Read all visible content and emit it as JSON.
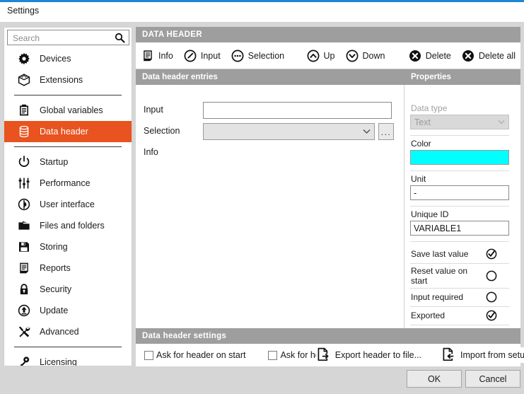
{
  "window": {
    "title": "Settings",
    "accent_color": "#1f86d6"
  },
  "search": {
    "placeholder": "Search",
    "value": "",
    "icon": "search-icon"
  },
  "sidebar": {
    "groups": [
      {
        "items": [
          {
            "label": "Devices",
            "icon": "gear-icon",
            "selected": false
          },
          {
            "label": "Extensions",
            "icon": "box-icon",
            "selected": false
          }
        ]
      },
      {
        "items": [
          {
            "label": "Global variables",
            "icon": "clipboard-icon",
            "selected": false
          },
          {
            "label": "Data header",
            "icon": "database-icon",
            "selected": true
          }
        ]
      },
      {
        "items": [
          {
            "label": "Startup",
            "icon": "power-icon",
            "selected": false
          },
          {
            "label": "Performance",
            "icon": "sliders-icon",
            "selected": false
          },
          {
            "label": "User interface",
            "icon": "user-interface-icon",
            "selected": false
          },
          {
            "label": "Files and folders",
            "icon": "folder-icon",
            "selected": false
          },
          {
            "label": "Storing",
            "icon": "floppy-disk-icon",
            "selected": false
          },
          {
            "label": "Reports",
            "icon": "report-icon",
            "selected": false
          },
          {
            "label": "Security",
            "icon": "lock-icon",
            "selected": false
          },
          {
            "label": "Update",
            "icon": "update-icon",
            "selected": false
          },
          {
            "label": "Advanced",
            "icon": "tools-icon",
            "selected": false
          }
        ]
      },
      {
        "items": [
          {
            "label": "Licensing",
            "icon": "key-icon",
            "selected": false
          }
        ]
      }
    ],
    "selected_color": "#e8531f"
  },
  "main": {
    "header": "DATA HEADER",
    "toolbar": [
      {
        "label": "Info",
        "icon": "document-lines-icon"
      },
      {
        "label": "Input",
        "icon": "pencil-circle-icon"
      },
      {
        "label": "Selection",
        "icon": "ellipsis-circle-icon"
      },
      {
        "label": "Up",
        "icon": "chevron-up-circle-icon"
      },
      {
        "label": "Down",
        "icon": "chevron-down-circle-icon"
      },
      {
        "label": "Delete",
        "icon": "x-circle-icon"
      },
      {
        "label": "Delete all",
        "icon": "x-circle-icon"
      }
    ],
    "entries": {
      "header": "Data header entries",
      "rows": [
        {
          "label": "Input",
          "type": "text",
          "value": ""
        },
        {
          "label": "Selection",
          "type": "combo",
          "value": ""
        },
        {
          "label": "Info",
          "type": "none",
          "value": ""
        }
      ],
      "browse_button": "..."
    },
    "properties": {
      "header": "Properties",
      "data_type": {
        "label": "Data type",
        "value": "Text",
        "disabled": true
      },
      "color": {
        "label": "Color",
        "value": "#00ffff"
      },
      "unit": {
        "label": "Unit",
        "value": "-"
      },
      "unique_id": {
        "label": "Unique ID",
        "value": "VARIABLE1"
      },
      "toggles": [
        {
          "label": "Save last value",
          "checked": true
        },
        {
          "label": "Reset value on start",
          "checked": false
        },
        {
          "label": "Input required",
          "checked": false
        },
        {
          "label": "Exported",
          "checked": true
        }
      ]
    },
    "settings": {
      "header": "Data header settings",
      "checkboxes": [
        {
          "label": "Ask for header on start",
          "checked": false
        },
        {
          "label": "Ask for he",
          "checked": false
        }
      ],
      "buttons": [
        {
          "label": "Export header to file...",
          "icon": "export-file-icon"
        },
        {
          "label": "Import from setup file...",
          "icon": "import-file-icon"
        }
      ]
    }
  },
  "footer": {
    "ok": "OK",
    "cancel": "Cancel"
  }
}
